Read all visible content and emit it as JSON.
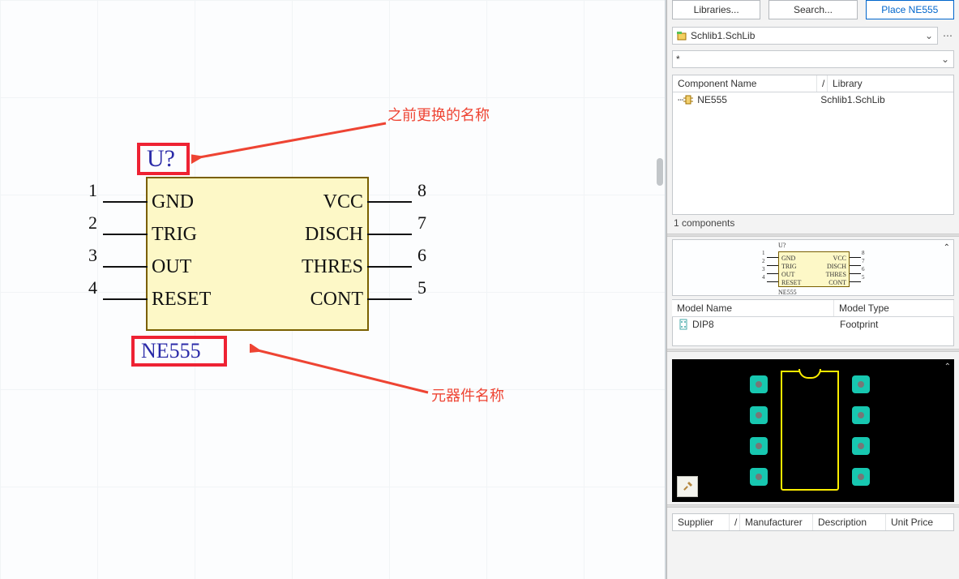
{
  "annotations": {
    "designator_note": "之前更换的名称",
    "name_note": "元器件名称"
  },
  "component": {
    "designator": "U?",
    "name": "NE555",
    "pins_left": [
      {
        "num": "1",
        "label": "GND"
      },
      {
        "num": "2",
        "label": "TRIG"
      },
      {
        "num": "3",
        "label": "OUT"
      },
      {
        "num": "4",
        "label": "RESET"
      }
    ],
    "pins_right": [
      {
        "num": "8",
        "label": "VCC"
      },
      {
        "num": "7",
        "label": "DISCH"
      },
      {
        "num": "6",
        "label": "THRES"
      },
      {
        "num": "5",
        "label": "CONT"
      }
    ]
  },
  "panel": {
    "btn_lib": "Libraries...",
    "btn_search": "Search...",
    "btn_place": "Place NE555",
    "lib_select": "Schlib1.SchLib",
    "filter_text": "*",
    "list_hdr_name": "Component Name",
    "list_hdr_lib": "Library",
    "rows": [
      {
        "name": "NE555",
        "lib": "Schlib1.SchLib"
      }
    ],
    "count_text": "1 components",
    "model_hdr_name": "Model Name",
    "model_hdr_type": "Model Type",
    "models": [
      {
        "name": "DIP8",
        "type": "Footprint"
      }
    ],
    "sup_cols": [
      "Supplier",
      "Manufacturer",
      "Description",
      "Unit Price"
    ]
  },
  "mini": {
    "designator": "U?",
    "name": "NE555",
    "left": [
      "GND",
      "TRIG",
      "OUT",
      "RESET"
    ],
    "right": [
      "VCC",
      "DISCH",
      "THRES",
      "CONT"
    ],
    "ln": [
      "1",
      "2",
      "3",
      "4"
    ],
    "rn": [
      "8",
      "7",
      "6",
      "5"
    ]
  }
}
